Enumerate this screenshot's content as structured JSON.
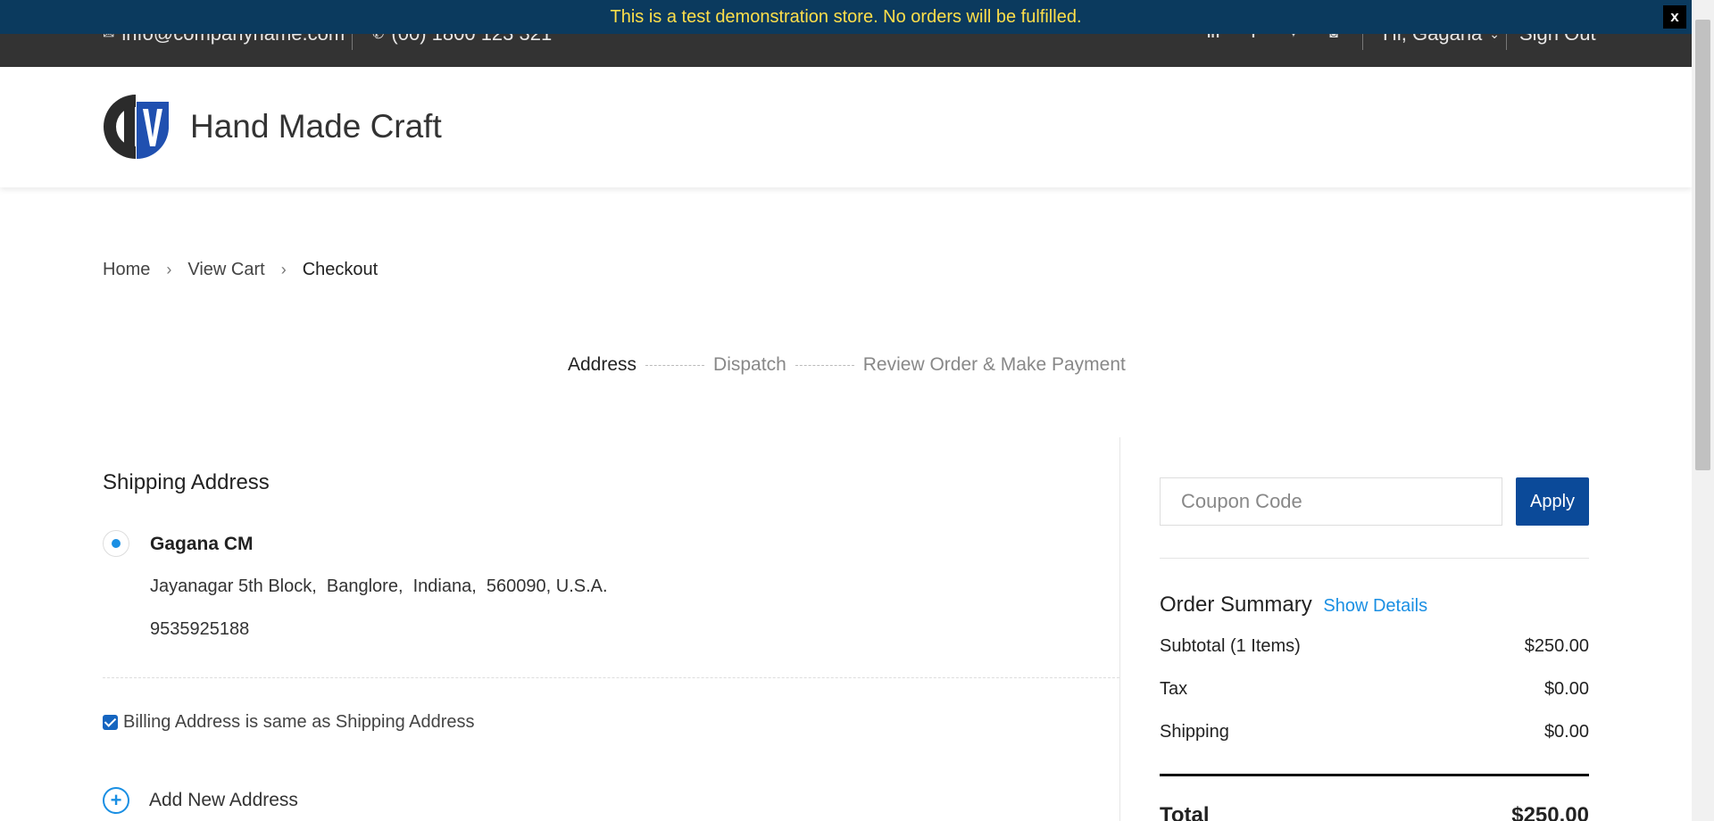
{
  "banner": {
    "text": "This is a test demonstration store. No orders will be fulfilled.",
    "close_label": "x"
  },
  "topbar": {
    "email": "info@companyname.com",
    "phone": "(00) 1800 123 321",
    "greeting": "Hi, Gagana",
    "sign_out": "Sign Out",
    "social_icons": [
      "linkedin-icon",
      "facebook-icon",
      "twitter-icon",
      "instagram-icon"
    ]
  },
  "header": {
    "brand": "Hand Made Craft"
  },
  "breadcrumb": {
    "items": [
      "Home",
      "View Cart",
      "Checkout"
    ]
  },
  "steps": {
    "items": [
      "Address",
      "Dispatch",
      "Review Order & Make Payment"
    ],
    "active_index": 0
  },
  "shipping": {
    "title": "Shipping Address",
    "name": "Gagana CM",
    "address_line": "Jayanagar 5th Block,  Banglore,  Indiana,  560090, U.S.A.",
    "phone": "9535925188",
    "selected": true
  },
  "billing": {
    "label": "Billing Address is same as Shipping Address",
    "checked": true
  },
  "add_address": {
    "label": "Add New Address"
  },
  "coupon": {
    "placeholder": "Coupon Code",
    "apply_label": "Apply"
  },
  "summary": {
    "title": "Order Summary",
    "show_details": "Show Details",
    "rows": [
      {
        "label": "Subtotal (1 Items)",
        "value": "$250.00"
      },
      {
        "label": "Tax",
        "value": "$0.00"
      },
      {
        "label": "Shipping",
        "value": "$0.00"
      }
    ],
    "total_label": "Total",
    "total_value": "$250.00"
  },
  "colors": {
    "banner_bg": "#0b3a5e",
    "banner_text": "#ffdf4a",
    "topbar_bg": "#333333",
    "accent": "#1a8fe3",
    "button": "#0b4a99"
  }
}
